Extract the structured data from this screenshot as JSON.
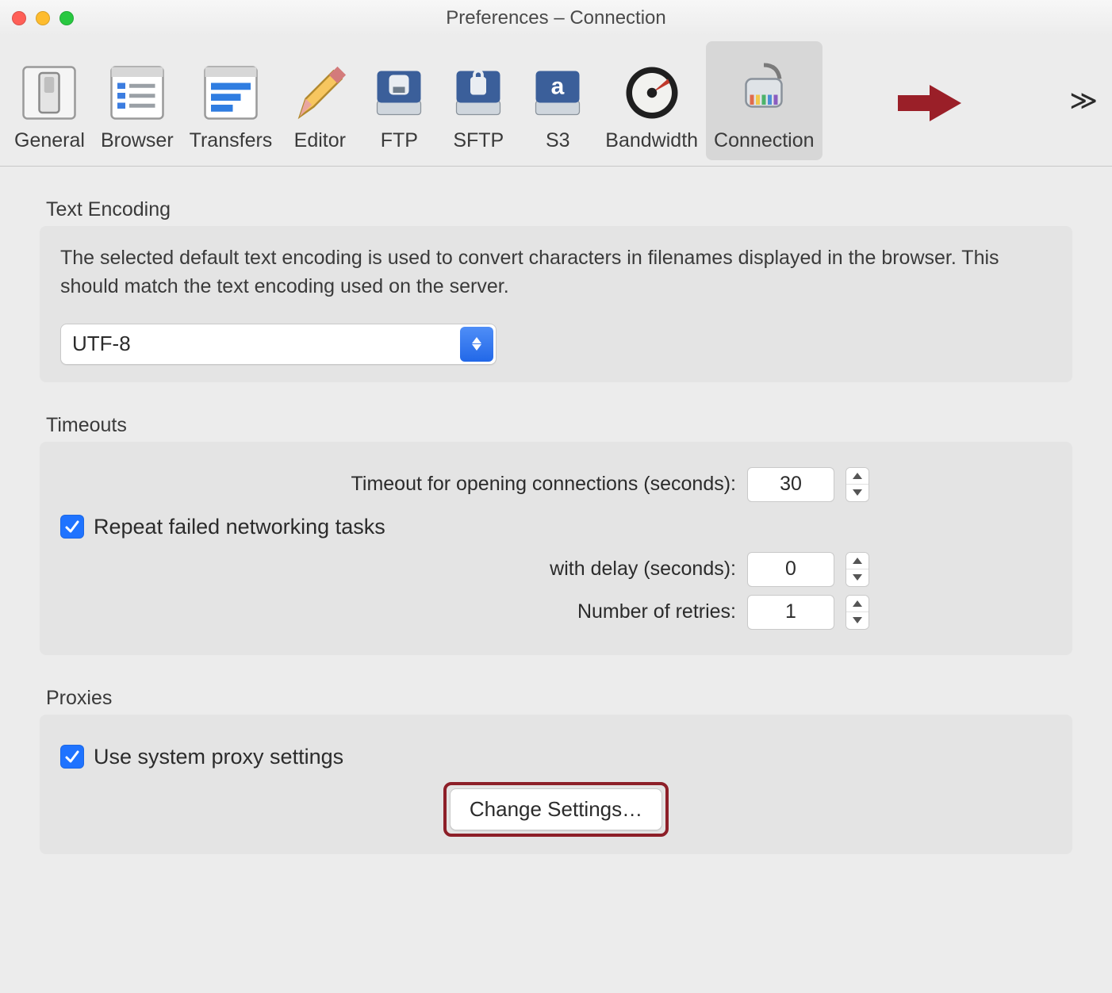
{
  "window": {
    "title": "Preferences – Connection"
  },
  "toolbar": {
    "items": [
      {
        "label": "General"
      },
      {
        "label": "Browser"
      },
      {
        "label": "Transfers"
      },
      {
        "label": "Editor"
      },
      {
        "label": "FTP"
      },
      {
        "label": "SFTP"
      },
      {
        "label": "S3"
      },
      {
        "label": "Bandwidth"
      },
      {
        "label": "Connection"
      }
    ],
    "active_index": 8
  },
  "text_encoding": {
    "section_label": "Text Encoding",
    "description": "The selected default text encoding is used to convert characters in filenames displayed in the browser. This should match the text encoding used on the server.",
    "selected": "UTF-8"
  },
  "timeouts": {
    "section_label": "Timeouts",
    "open_label": "Timeout for opening connections (seconds):",
    "open_value": "30",
    "repeat_label": "Repeat failed networking tasks",
    "repeat_checked": true,
    "delay_label": "with delay (seconds):",
    "delay_value": "0",
    "retries_label": "Number of retries:",
    "retries_value": "1"
  },
  "proxies": {
    "section_label": "Proxies",
    "use_system_label": "Use system proxy settings",
    "use_system_checked": true,
    "change_button": "Change Settings…"
  }
}
